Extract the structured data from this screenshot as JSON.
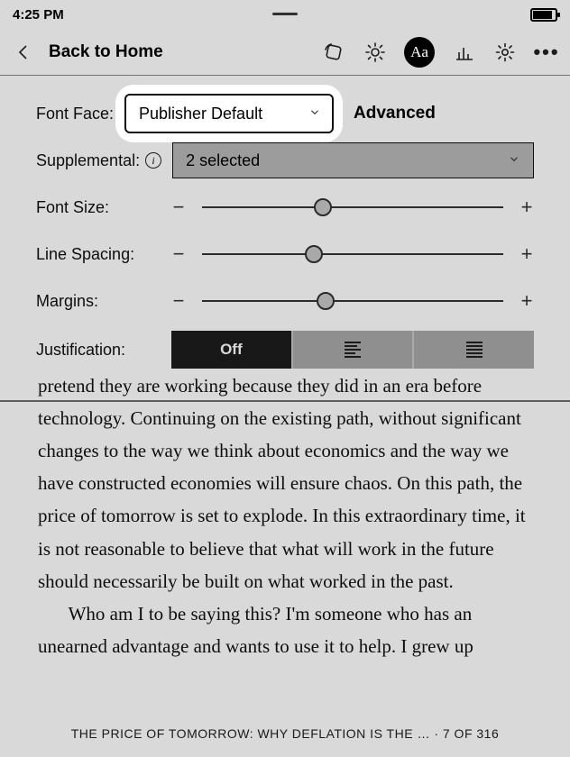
{
  "status": {
    "time": "4:25 PM"
  },
  "toolbar": {
    "back_label": "Back to Home"
  },
  "panel": {
    "font_face_label": "Font Face:",
    "font_face_value": "Publisher Default",
    "advanced_label": "Advanced",
    "supplemental_label": "Supplemental:",
    "supplemental_value": "2 selected",
    "font_size_label": "Font Size:",
    "line_spacing_label": "Line Spacing:",
    "margins_label": "Margins:",
    "justification_label": "Justification:",
    "justification_off": "Off",
    "sliders": {
      "font_size_pct": 40,
      "line_spacing_pct": 37,
      "margins_pct": 41
    }
  },
  "reading": {
    "para1": "pretend they are working because they did in an era before technology. Continuing on the existing path, without significant changes to the way we think about economics and the way we have constructed economies will ensure chaos. On this path, the price of tomorrow is set to explode. In this extraordinary time, it is not reasonable to believe that what will work in the future should necessarily be built on what worked in the past.",
    "para2": "Who am I to be saying this? I'm someone who has an unearned advantage and wants to use it to help. I grew up",
    "footer": "THE PRICE OF TOMORROW: WHY DEFLATION IS THE … · 7 OF 316"
  }
}
